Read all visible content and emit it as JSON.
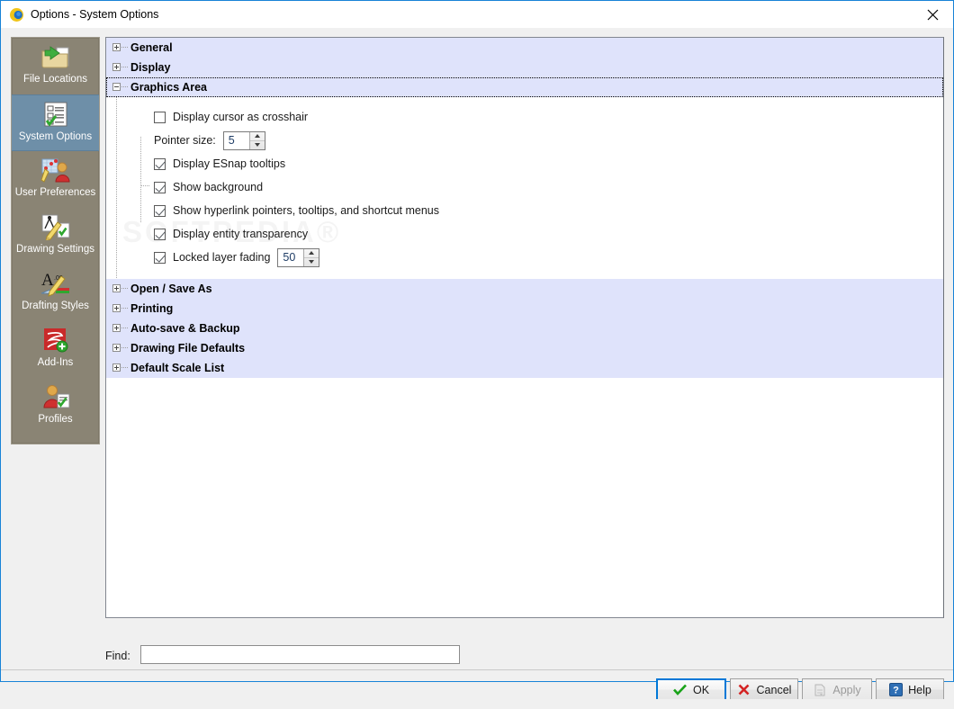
{
  "window": {
    "title": "Options - System Options",
    "app_icon": "draftsight-logo-icon",
    "close_icon": "close-icon",
    "accent_color": "#1883d7"
  },
  "sidebar": {
    "background_color": "#8a8474",
    "selected_color": "#6e8fa8",
    "items": [
      {
        "label": "File Locations",
        "icon": "folder-arrow-icon",
        "selected": false
      },
      {
        "label": "System Options",
        "icon": "checklist-icon",
        "selected": true
      },
      {
        "label": "User Preferences",
        "icon": "user-chart-icon",
        "selected": false
      },
      {
        "label": "Drawing Settings",
        "icon": "pencil-drawing-icon",
        "selected": false
      },
      {
        "label": "Drafting Styles",
        "icon": "text-style-icon",
        "selected": false
      },
      {
        "label": "Add-Ins",
        "icon": "addin-plus-icon",
        "selected": false
      },
      {
        "label": "Profiles",
        "icon": "user-profile-icon",
        "selected": false
      }
    ]
  },
  "tree": {
    "group_background": "#dfe3fb",
    "top_groups": [
      {
        "label": "General",
        "expander": "plus",
        "expanded": false,
        "focused": false
      },
      {
        "label": "Display",
        "expander": "plus",
        "expanded": false,
        "focused": false
      },
      {
        "label": "Graphics Area",
        "expander": "minus",
        "expanded": true,
        "focused": true
      }
    ],
    "graphics_area_options": [
      {
        "type": "checkbox",
        "label": "Display cursor as crosshair",
        "checked": false
      },
      {
        "type": "spinner",
        "label": "Pointer size:",
        "value": "5"
      },
      {
        "type": "checkbox",
        "label": "Display ESnap tooltips",
        "checked": true
      },
      {
        "type": "checkbox",
        "label": "Show background",
        "checked": true,
        "last_child": true
      },
      {
        "type": "checkbox",
        "label": "Show hyperlink pointers, tooltips, and shortcut menus",
        "checked": true
      },
      {
        "type": "checkbox",
        "label": "Display entity transparency",
        "checked": true
      },
      {
        "type": "checkbox-spinner",
        "label": "Locked layer fading",
        "checked": true,
        "value": "50"
      }
    ],
    "bottom_groups": [
      {
        "label": "Open / Save As",
        "expander": "plus",
        "expanded": false
      },
      {
        "label": "Printing",
        "expander": "plus",
        "expanded": false
      },
      {
        "label": "Auto-save & Backup",
        "expander": "plus",
        "expanded": false
      },
      {
        "label": "Drawing File Defaults",
        "expander": "plus",
        "expanded": false
      },
      {
        "label": "Default Scale List",
        "expander": "plus",
        "expanded": false
      }
    ]
  },
  "find": {
    "label": "Find:",
    "value": "",
    "placeholder": ""
  },
  "watermark": {
    "text": "SOFTPEDIA®"
  },
  "buttons": {
    "ok": {
      "label": "OK",
      "icon": "green-check-icon",
      "focused": true,
      "disabled": false
    },
    "cancel": {
      "label": "Cancel",
      "icon": "red-x-icon",
      "focused": false,
      "disabled": false
    },
    "apply": {
      "label": "Apply",
      "icon": "apply-page-icon",
      "focused": false,
      "disabled": true
    },
    "help": {
      "label": "Help",
      "icon": "question-help-icon",
      "focused": false,
      "disabled": false
    }
  }
}
